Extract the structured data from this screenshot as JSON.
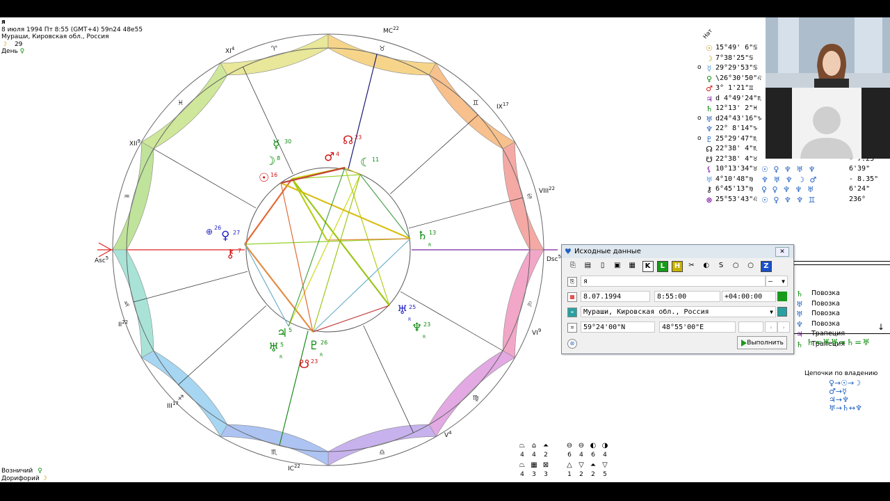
{
  "header": {
    "name": "я",
    "datetime": "8 июля 1994  Пт   8:55 (GMT+4) 59n24  48e55",
    "place": "Мураши, Кировская обл., Россия",
    "moon_day_glyph": "☽",
    "moon_day": "29",
    "day_label": "День",
    "day_ruler": "♀"
  },
  "chart": {
    "houses": [
      {
        "label": "Asc",
        "sup": "5"
      },
      {
        "label": "XII",
        "sup": "9"
      },
      {
        "label": "XI",
        "sup": "4"
      },
      {
        "label": "MC",
        "sup": "22"
      },
      {
        "label": "IX",
        "sup": "17"
      },
      {
        "label": "VIII",
        "sup": "22"
      },
      {
        "label": "Dsc",
        "sup": "5"
      },
      {
        "label": "VI",
        "sup": "9"
      },
      {
        "label": "V",
        "sup": "4"
      },
      {
        "label": "IC",
        "sup": "22"
      },
      {
        "label": "III",
        "sup": "17"
      },
      {
        "label": "II",
        "sup": "22"
      }
    ],
    "planets": [
      {
        "glyph": "☿",
        "deg": "30",
        "color": "#0a8a0a"
      },
      {
        "glyph": "☽",
        "deg": "8",
        "color": "#0a8a0a"
      },
      {
        "glyph": "☉",
        "deg": "16",
        "color": "#d01010"
      },
      {
        "glyph": "♂",
        "deg": "4",
        "color": "#d01010"
      },
      {
        "glyph": "☊",
        "deg": "23",
        "color": "#d01010"
      },
      {
        "glyph": "☾",
        "deg": "11",
        "color": "#0a8a0a"
      },
      {
        "glyph": "⊕",
        "deg": "26",
        "color": "#2020c0"
      },
      {
        "glyph": "♀",
        "deg": "27",
        "color": "#2020c0"
      },
      {
        "glyph": "⚷",
        "deg": "7",
        "color": "#d01010"
      },
      {
        "glyph": "♄",
        "deg": "13",
        "color": "#0a8a0a"
      },
      {
        "glyph": "♅",
        "deg": "25",
        "color": "#2020c0"
      },
      {
        "glyph": "♆",
        "deg": "23",
        "color": "#0a8a0a"
      },
      {
        "glyph": "♃",
        "deg": "5",
        "color": "#0a8a0a"
      },
      {
        "glyph": "♅",
        "deg": "5",
        "color": "#0a8a0a"
      },
      {
        "glyph": "♇",
        "deg": "26",
        "color": "#0a8a0a"
      },
      {
        "glyph": "☋",
        "deg": "23",
        "color": "#d01010"
      }
    ],
    "retro": "R"
  },
  "planet_table": {
    "column_label": "Нат",
    "rows": [
      {
        "flag": "",
        "glyph": "☉",
        "color": "#c89000",
        "pos": "15°49' 6\"♋",
        "aspects": "",
        "val": ""
      },
      {
        "flag": "",
        "glyph": "☽",
        "color": "#c8a000",
        "pos": "7°38'25\"♋",
        "aspects": "",
        "val": ""
      },
      {
        "flag": "o",
        "glyph": "☿",
        "color": "#5599dd",
        "pos": "29°29'53\"♋",
        "aspects": "",
        "val": ""
      },
      {
        "flag": "",
        "glyph": "♀",
        "color": "#0a8a0a",
        "pos": "\\26°30'50\"♌",
        "aspects": "",
        "val": ""
      },
      {
        "flag": "",
        "glyph": "♂",
        "color": "#d01010",
        "pos": "3° 1'21\"♊",
        "aspects": "",
        "val": ""
      },
      {
        "flag": "",
        "glyph": "♃",
        "color": "#8a22aa",
        "pos": "d 4°49'24\"♏",
        "aspects": "",
        "val": ""
      },
      {
        "flag": "",
        "glyph": "♄",
        "color": "#0a8a0a",
        "pos": "12°13' 2\"♓",
        "aspects": "",
        "val": ""
      },
      {
        "flag": "o",
        "glyph": "♅",
        "color": "#2060c0",
        "pos": "d24°43'16\"♑",
        "aspects": "",
        "val": ""
      },
      {
        "flag": "",
        "glyph": "♆",
        "color": "#2060c0",
        "pos": "22° 8'14\"♑",
        "aspects": "",
        "val": ""
      },
      {
        "flag": "o",
        "glyph": "♇",
        "color": "#2060c0",
        "pos": "25°29'47\"♏",
        "aspects": "",
        "val": ""
      },
      {
        "flag": "",
        "glyph": "☊",
        "color": "#000000",
        "pos": "22°38' 4\"♏",
        "aspects": "",
        "val": ""
      },
      {
        "flag": "",
        "glyph": "☋",
        "color": "#000000",
        "pos": "22°38' 4\"♉",
        "aspects": "",
        "val": "- 7.23"
      },
      {
        "flag": "",
        "glyph": "⚸",
        "color": "#8a22aa",
        "pos": "10°13'34\"♉",
        "aspects": "☉ ♀ ♆ ♅ ♆",
        "val": "6'39\""
      },
      {
        "flag": "",
        "glyph": "♅",
        "color": "#5599dd",
        "pos": "4°10'48\"♍",
        "aspects": "♆ ♅ ♆ ☽ ♂",
        "val": "- 8.35\""
      },
      {
        "flag": "",
        "glyph": "⚷",
        "color": "#000000",
        "pos": "6°45'13\"♍",
        "aspects": "♀ ♀ ♆ ♆ ♅",
        "val": "6'24\""
      },
      {
        "flag": "",
        "glyph": "⊗",
        "color": "#8a22aa",
        "pos": "25°53'43\"♌",
        "aspects": "☉ ♀ ♆ ♆ ♊",
        "val": "236°"
      }
    ]
  },
  "dialog": {
    "title": "Исходные данные",
    "close": "✕",
    "name_value": "я",
    "name_dropdown": "—",
    "date_value": "8.07.1994",
    "time_value": "8:55:00",
    "zone_value": "+04:00:00",
    "place_value": "Мураши, Кировская обл., Россия",
    "lat_value": "59°24'00\"N",
    "lon_value": "48°55'00\"E",
    "run_label": "Выполнить",
    "toolbar": [
      "⎘",
      "▤",
      "▯",
      "▣",
      "▦",
      "K",
      "L",
      "H",
      "✂",
      "◐",
      "S",
      "○",
      "○",
      "Z"
    ]
  },
  "config_list": {
    "items": [
      {
        "glyph": "♄",
        "label": "Повозка"
      },
      {
        "glyph": "♅",
        "label": "Повозка"
      },
      {
        "glyph": "♅",
        "label": "Повозка"
      },
      {
        "glyph": "♆",
        "label": "Повозка"
      },
      {
        "glyph": "♃",
        "label": "Трапеция"
      },
      {
        "glyph": "♄",
        "label": "Трапеция"
      }
    ],
    "reception_row": "♄=♅♅=♄=♅",
    "chains_title": "Цепочки по владению",
    "chains": [
      "♀→☉→☽",
      "♂→☿",
      "♃→♆",
      "♅→♄↔♆"
    ]
  },
  "stats": {
    "top_syms": [
      "⏢",
      "⌂",
      "⏶",
      "⊖",
      "⊖",
      "◐",
      "◑"
    ],
    "top_nums": [
      "4",
      "4",
      "2",
      "6",
      "4",
      "6",
      "4"
    ],
    "bottom_syms": [
      "⏢",
      "▦",
      "⊠",
      "△",
      "▽",
      "⏶",
      "▽"
    ],
    "bottom_nums": [
      "4",
      "3",
      "3",
      "1",
      "2",
      "2",
      "5"
    ]
  },
  "footer": {
    "vozn_label": "Возничий",
    "vozn_glyph": "♀",
    "dorif_label": "Дорифорий",
    "dorif_glyph": "☽"
  }
}
